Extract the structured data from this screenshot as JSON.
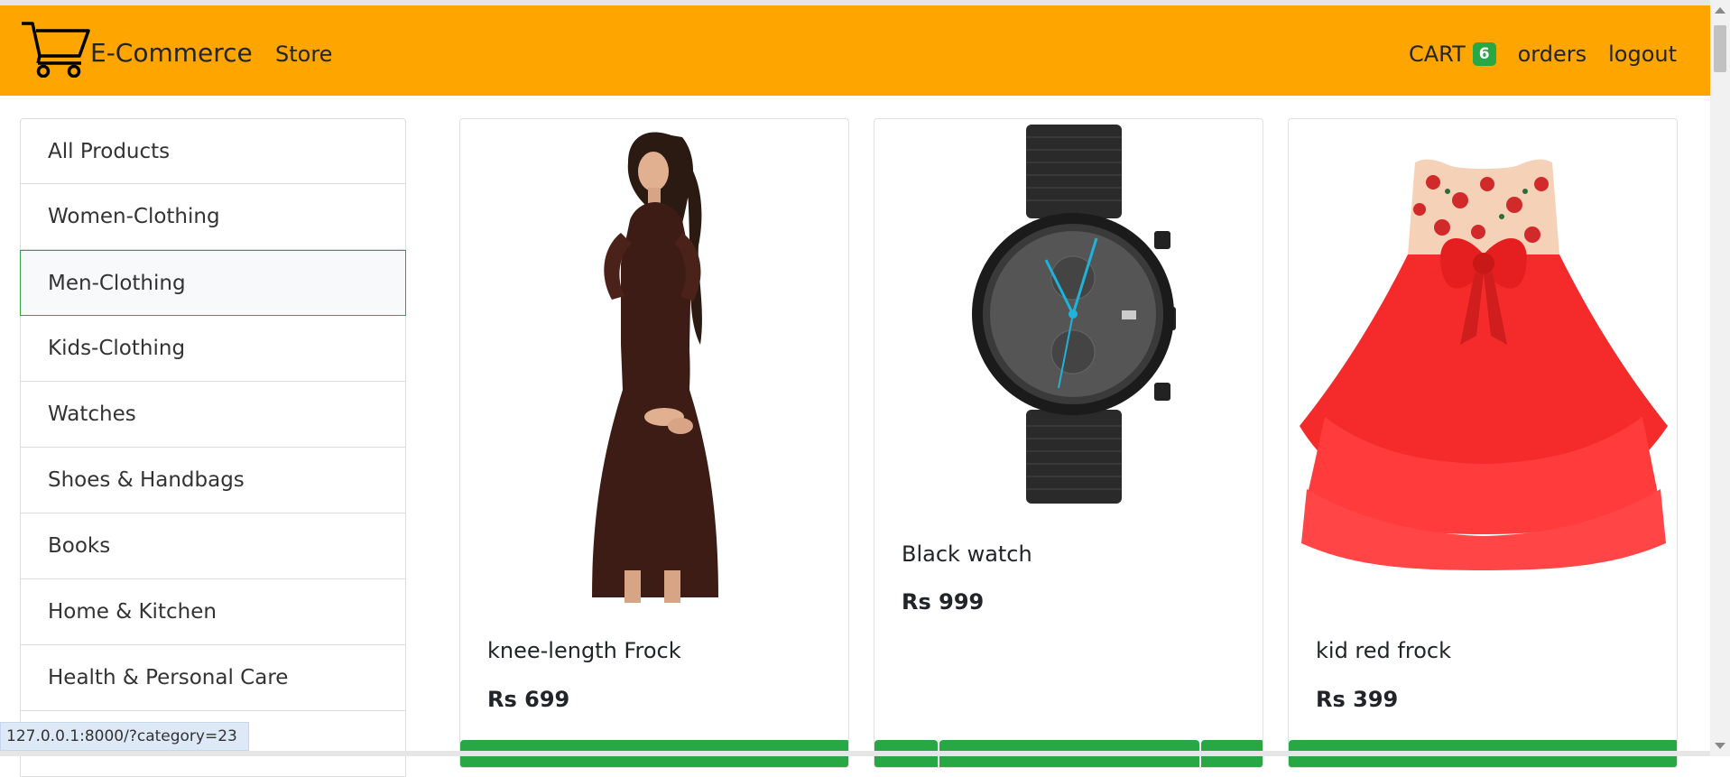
{
  "navbar": {
    "brand": "E-Commerce",
    "store_link": "Store",
    "cart_label": "CART",
    "cart_count": "6",
    "orders_link": "orders",
    "logout_link": "logout",
    "logo_icon": "shopping-cart-icon",
    "background_color": "#ffa500"
  },
  "sidebar": {
    "items": [
      {
        "label": "All Products"
      },
      {
        "label": "Women-Clothing"
      },
      {
        "label": "Men-Clothing"
      },
      {
        "label": "Kids-Clothing"
      },
      {
        "label": "Watches"
      },
      {
        "label": "Shoes & Handbags"
      },
      {
        "label": "Books"
      },
      {
        "label": "Home & Kitchen"
      },
      {
        "label": "Health & Personal Care"
      }
    ],
    "active_index": 2,
    "active_color": "#28a745"
  },
  "products": [
    {
      "title": "knee-length Frock",
      "price": "Rs 699",
      "image": "brown-dress-image"
    },
    {
      "title": "Black watch",
      "price": "Rs 999",
      "image": "black-watch-image"
    },
    {
      "title": "kid red frock",
      "price": "Rs 399",
      "image": "red-frock-image"
    }
  ],
  "status_bar": {
    "url": "127.0.0.1:8000/?category=23"
  }
}
